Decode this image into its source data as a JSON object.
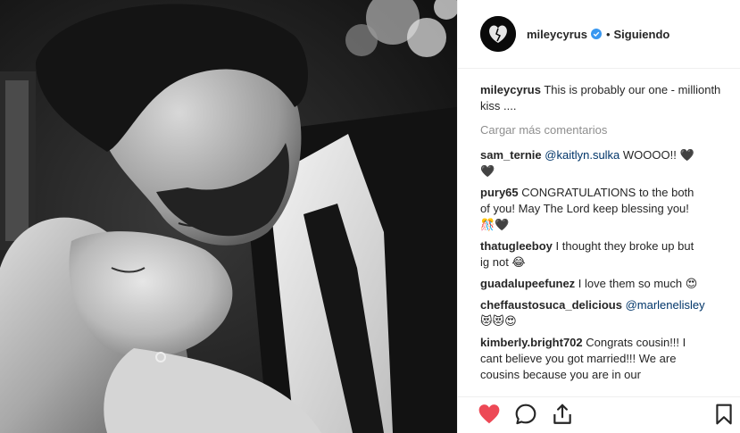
{
  "header": {
    "username": "mileycyrus",
    "separator": "•",
    "follow_label": "Siguiendo"
  },
  "caption": {
    "username": "mileycyrus",
    "text": " This is probably our one - millionth kiss ...."
  },
  "load_more_label": "Cargar más comentarios",
  "comments": [
    {
      "username": "sam_ternie",
      "mention": "@kaitlyn.sulka",
      "text": " WOOOO!! 🖤🖤"
    },
    {
      "username": "pury65",
      "mention": "",
      "text": " CONGRATULATIONS to the both of you! May The Lord keep blessing you! 🎊🖤"
    },
    {
      "username": "thatugleeboy",
      "mention": "",
      "text": " I thought they broke up but ig not 😂"
    },
    {
      "username": "guadalupeefunez",
      "mention": "",
      "text": " I love them so much 😍"
    },
    {
      "username": "cheffaustosuca_delicious",
      "mention": "@marlenelisley",
      "text": " 😻😻😍"
    },
    {
      "username": "kimberly.bright702",
      "mention": "",
      "text": " Congrats cousin!!! I cant believe you got married!!! We are cousins because you are in our"
    }
  ],
  "icons": {
    "like": "heart-filled-icon",
    "comment": "comment-bubble-icon",
    "share": "share-icon",
    "save": "bookmark-icon",
    "verified": "verified-badge-icon",
    "comment_like": "heart-outline-icon"
  },
  "colors": {
    "like_red": "#ed4956",
    "verified_blue": "#3897f0",
    "mention_blue": "#003569",
    "muted_gray": "#8e8e8e",
    "text": "#262626"
  }
}
